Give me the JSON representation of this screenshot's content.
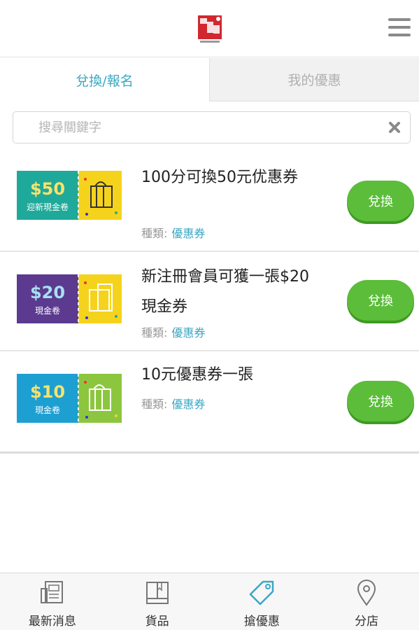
{
  "header": {
    "logo_icon": "app-logo",
    "menu_icon": "hamburger-menu-icon"
  },
  "tabs": [
    {
      "label": "兌換/報名",
      "active": true
    },
    {
      "label": "我的優惠",
      "active": false
    }
  ],
  "search": {
    "placeholder": "搜尋關鍵字",
    "value": "",
    "clear_icon": "clear-x-icon"
  },
  "category_label": "種類:",
  "items": [
    {
      "title": "100分可換50元优惠券",
      "category": "優惠券",
      "button": "兌換",
      "coupon": {
        "amount": "$50",
        "caption": "迎新現金卷",
        "left_color": "#1fa99a",
        "right_color": "#f5d31c"
      }
    },
    {
      "title": "新注冊會員可獲一張$20現金券",
      "category": "優惠券",
      "button": "兌換",
      "coupon": {
        "amount": "$20",
        "caption": "現金卷",
        "left_color": "#5b3a8f",
        "right_color": "#f5d31c"
      }
    },
    {
      "title": "10元優惠券一張",
      "category": "優惠券",
      "button": "兌換",
      "coupon": {
        "amount": "$10",
        "caption": "現金卷",
        "left_color": "#1e9fd2",
        "right_color": "#8cc63f"
      }
    }
  ],
  "bottom_nav": [
    {
      "label": "最新消息",
      "icon": "news-icon"
    },
    {
      "label": "貨品",
      "icon": "book-icon"
    },
    {
      "label": "搶優惠",
      "icon": "tag-icon",
      "active": true
    },
    {
      "label": "分店",
      "icon": "location-pin-icon"
    }
  ],
  "colors": {
    "accent": "#3aa7c4",
    "button_green": "#5bbd39",
    "logo_red": "#d0282e"
  }
}
